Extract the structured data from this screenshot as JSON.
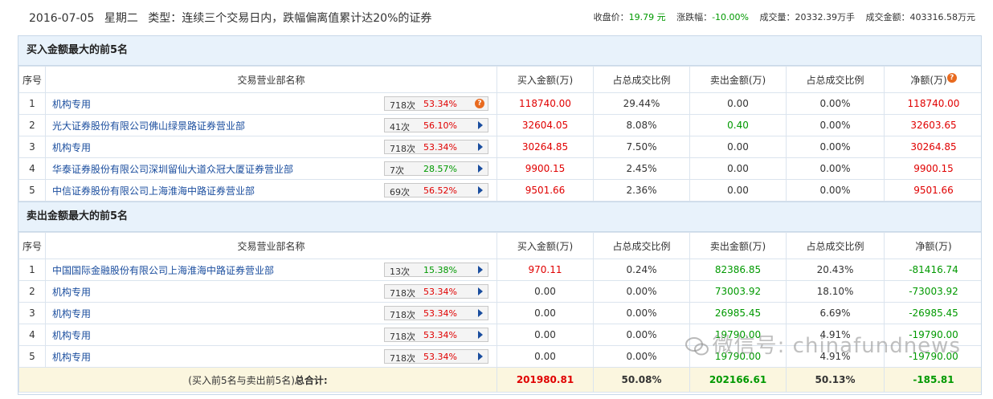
{
  "header": {
    "date": "2016-07-05",
    "weekday": "星期二",
    "type_label": "类型：",
    "type_text": "连续三个交易日内，跌幅偏离值累计达20%的证券",
    "close_label": "收盘价：",
    "close_value": "19.79 元",
    "change_label": "涨跌幅：",
    "change_value": "-10.00%",
    "volume_label": "成交量：",
    "volume_value": "20332.39万手",
    "amount_label": "成交金额：",
    "amount_value": "403316.58万元"
  },
  "columns": {
    "idx": "序号",
    "dept": "交易营业部名称",
    "buy": "买入金额(万)",
    "buy_ratio": "占总成交比例",
    "sell": "卖出金额(万)",
    "sell_ratio": "占总成交比例",
    "net": "净额(万)"
  },
  "buy_section": {
    "title": "买入金额最大的前5名",
    "rows": [
      {
        "idx": "1",
        "name": "机构专用",
        "count": "718次",
        "pct": "53.34%",
        "buy": "118740.00",
        "buy_ratio": "29.44%",
        "sell": "0.00",
        "sell_ratio": "0.00%",
        "net": "118740.00"
      },
      {
        "idx": "2",
        "name": "光大证券股份有限公司佛山绿景路证券营业部",
        "count": "41次",
        "pct": "56.10%",
        "buy": "32604.05",
        "buy_ratio": "8.08%",
        "sell": "0.40",
        "sell_ratio": "0.00%",
        "net": "32603.65"
      },
      {
        "idx": "3",
        "name": "机构专用",
        "count": "718次",
        "pct": "53.34%",
        "buy": "30264.85",
        "buy_ratio": "7.50%",
        "sell": "0.00",
        "sell_ratio": "0.00%",
        "net": "30264.85"
      },
      {
        "idx": "4",
        "name": "华泰证券股份有限公司深圳留仙大道众冠大厦证券营业部",
        "count": "7次",
        "pct": "28.57%",
        "buy": "9900.15",
        "buy_ratio": "2.45%",
        "sell": "0.00",
        "sell_ratio": "0.00%",
        "net": "9900.15"
      },
      {
        "idx": "5",
        "name": "中信证券股份有限公司上海淮海中路证券营业部",
        "count": "69次",
        "pct": "56.52%",
        "buy": "9501.66",
        "buy_ratio": "2.36%",
        "sell": "0.00",
        "sell_ratio": "0.00%",
        "net": "9501.66"
      }
    ]
  },
  "sell_section": {
    "title": "卖出金额最大的前5名",
    "rows": [
      {
        "idx": "1",
        "name": "中国国际金融股份有限公司上海淮海中路证券营业部",
        "count": "13次",
        "pct": "15.38%",
        "buy": "970.11",
        "buy_ratio": "0.24%",
        "sell": "82386.85",
        "sell_ratio": "20.43%",
        "net": "-81416.74"
      },
      {
        "idx": "2",
        "name": "机构专用",
        "count": "718次",
        "pct": "53.34%",
        "buy": "0.00",
        "buy_ratio": "0.00%",
        "sell": "73003.92",
        "sell_ratio": "18.10%",
        "net": "-73003.92"
      },
      {
        "idx": "3",
        "name": "机构专用",
        "count": "718次",
        "pct": "53.34%",
        "buy": "0.00",
        "buy_ratio": "0.00%",
        "sell": "26985.45",
        "sell_ratio": "6.69%",
        "net": "-26985.45"
      },
      {
        "idx": "4",
        "name": "机构专用",
        "count": "718次",
        "pct": "53.34%",
        "buy": "0.00",
        "buy_ratio": "0.00%",
        "sell": "19790.00",
        "sell_ratio": "4.91%",
        "net": "-19790.00"
      },
      {
        "idx": "5",
        "name": "机构专用",
        "count": "718次",
        "pct": "53.34%",
        "buy": "0.00",
        "buy_ratio": "0.00%",
        "sell": "19790.00",
        "sell_ratio": "4.91%",
        "net": "-19790.00"
      }
    ]
  },
  "total": {
    "label_prefix": "(买入前5名与卖出前5名)",
    "label_bold": "总合计:",
    "buy": "201980.81",
    "buy_ratio": "50.08%",
    "sell": "202166.61",
    "sell_ratio": "50.13%",
    "net": "-185.81"
  },
  "help_glyph": "?",
  "watermark": "微信号: chinafundnews",
  "colors": {
    "up": "#e00000",
    "down": "#009900",
    "link": "#1a4d9e",
    "bar": "#e8f2fb",
    "total_bg": "#fbf6df"
  }
}
